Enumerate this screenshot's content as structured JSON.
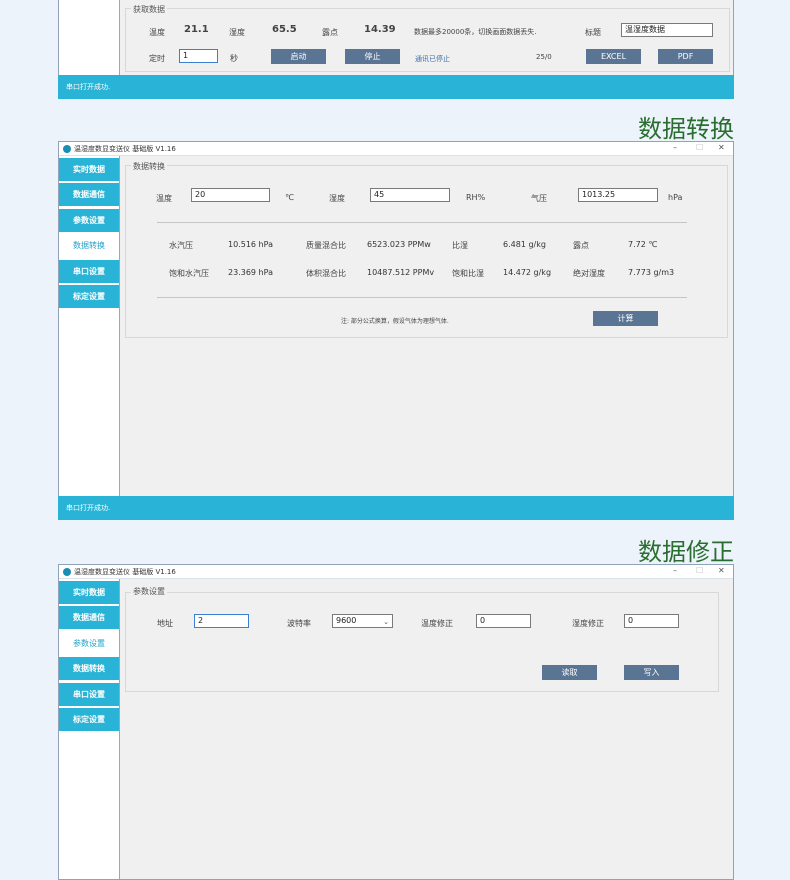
{
  "top_window": {
    "group_title": "获取数据",
    "temp_label": "温度",
    "temp_value": "21.1",
    "hum_label": "湿度",
    "hum_value": "65.5",
    "dew_label": "露点",
    "dew_value": "14.39",
    "note": "数据最多20000条，切换画面数据丢失.",
    "title_label": "标题",
    "title_value": "温湿度数据",
    "timer_label": "定时",
    "timer_value": "1",
    "timer_unit": "秒",
    "start_button": "启动",
    "stop_button": "停止",
    "comm_status": "通讯已停止",
    "count": "25/0",
    "excel_button": "EXCEL",
    "pdf_button": "PDF",
    "status": "串口打开成功."
  },
  "heading_convert": "数据转换",
  "heading_correct": "数据修正",
  "window_title": "温湿度数显变送仪 基础版 V1.16",
  "window_controls": {
    "minimize": "–",
    "maximize": "☐",
    "close": "✕"
  },
  "sidebar_items": [
    "实时数据",
    "数据通信",
    "参数设置",
    "数据转换",
    "串口设置",
    "标定设置"
  ],
  "convert_window": {
    "group_title": "数据转换",
    "temp_label": "温度",
    "temp_value": "20",
    "temp_unit": "℃",
    "hum_label": "湿度",
    "hum_value": "45",
    "hum_unit": "RH%",
    "press_label": "气压",
    "press_value": "1013.25",
    "press_unit": "hPa",
    "results": [
      {
        "label": "水汽压",
        "value": "10.516 hPa"
      },
      {
        "label": "质量混合比",
        "value": "6523.023 PPMw"
      },
      {
        "label": "比湿",
        "value": "6.481 g/kg"
      },
      {
        "label": "露点",
        "value": "7.72 ℃"
      },
      {
        "label": "饱和水汽压",
        "value": "23.369 hPa"
      },
      {
        "label": "体积混合比",
        "value": "10487.512 PPMv"
      },
      {
        "label": "饱和比湿",
        "value": "14.472 g/kg"
      },
      {
        "label": "绝对湿度",
        "value": "7.773 g/m3"
      }
    ],
    "note": "注: 部分公式换算，假设气体为理想气体.",
    "calc_button": "计算",
    "status": "串口打开成功."
  },
  "param_window": {
    "group_title": "参数设置",
    "addr_label": "地址",
    "addr_value": "2",
    "baud_label": "波特率",
    "baud_value": "9600",
    "tcorr_label": "温度修正",
    "tcorr_value": "0",
    "hcorr_label": "湿度修正",
    "hcorr_value": "0",
    "read_button": "读取",
    "write_button": "写入"
  }
}
